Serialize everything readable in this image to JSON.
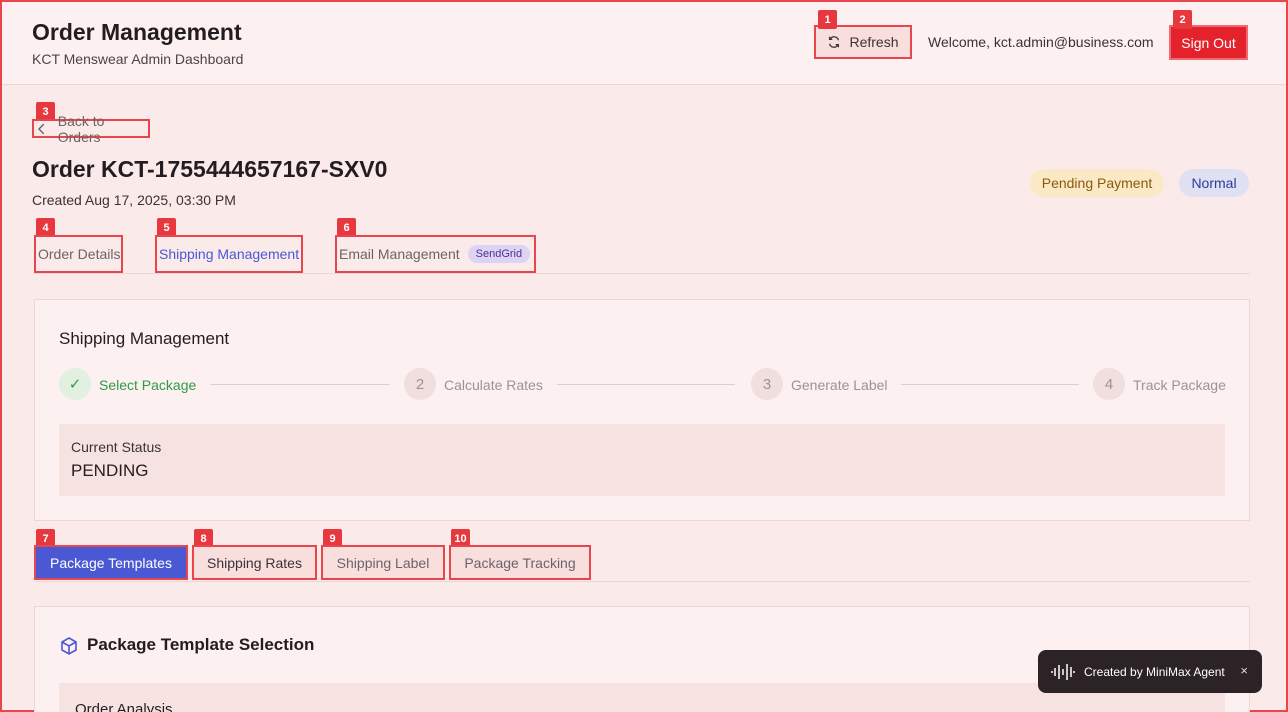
{
  "header": {
    "title": "Order Management",
    "subtitle": "KCT Menswear Admin Dashboard",
    "refresh_label": "Refresh",
    "welcome": "Welcome, kct.admin@business.com",
    "signout_label": "Sign Out"
  },
  "markers": [
    "1",
    "2",
    "3",
    "4",
    "5",
    "6",
    "7",
    "8",
    "9",
    "10"
  ],
  "order": {
    "back_label": "Back to Orders",
    "title": "Order KCT-1755444657167-SXV0",
    "created": "Created Aug 17, 2025, 03:30 PM",
    "payment_status": "Pending Payment",
    "priority": "Normal"
  },
  "tabs": {
    "details": "Order Details",
    "shipping": "Shipping Management",
    "email": "Email Management",
    "email_badge": "SendGrid"
  },
  "shipping": {
    "title": "Shipping Management",
    "steps": [
      {
        "number": "✓",
        "label": "Select Package"
      },
      {
        "number": "2",
        "label": "Calculate Rates"
      },
      {
        "number": "3",
        "label": "Generate Label"
      },
      {
        "number": "4",
        "label": "Track Package"
      }
    ],
    "status_label": "Current Status",
    "status_value": "PENDING"
  },
  "subtabs": {
    "templates": "Package Templates",
    "rates": "Shipping Rates",
    "label": "Shipping Label",
    "tracking": "Package Tracking"
  },
  "package": {
    "title": "Package Template Selection",
    "analysis_title": "Order Analysis"
  },
  "toast": {
    "text": "Created by MiniMax Agent",
    "close": "×"
  },
  "colors": {
    "accent": "#4a58d4",
    "danger": "#e3222b",
    "success": "#2e9a4a"
  }
}
